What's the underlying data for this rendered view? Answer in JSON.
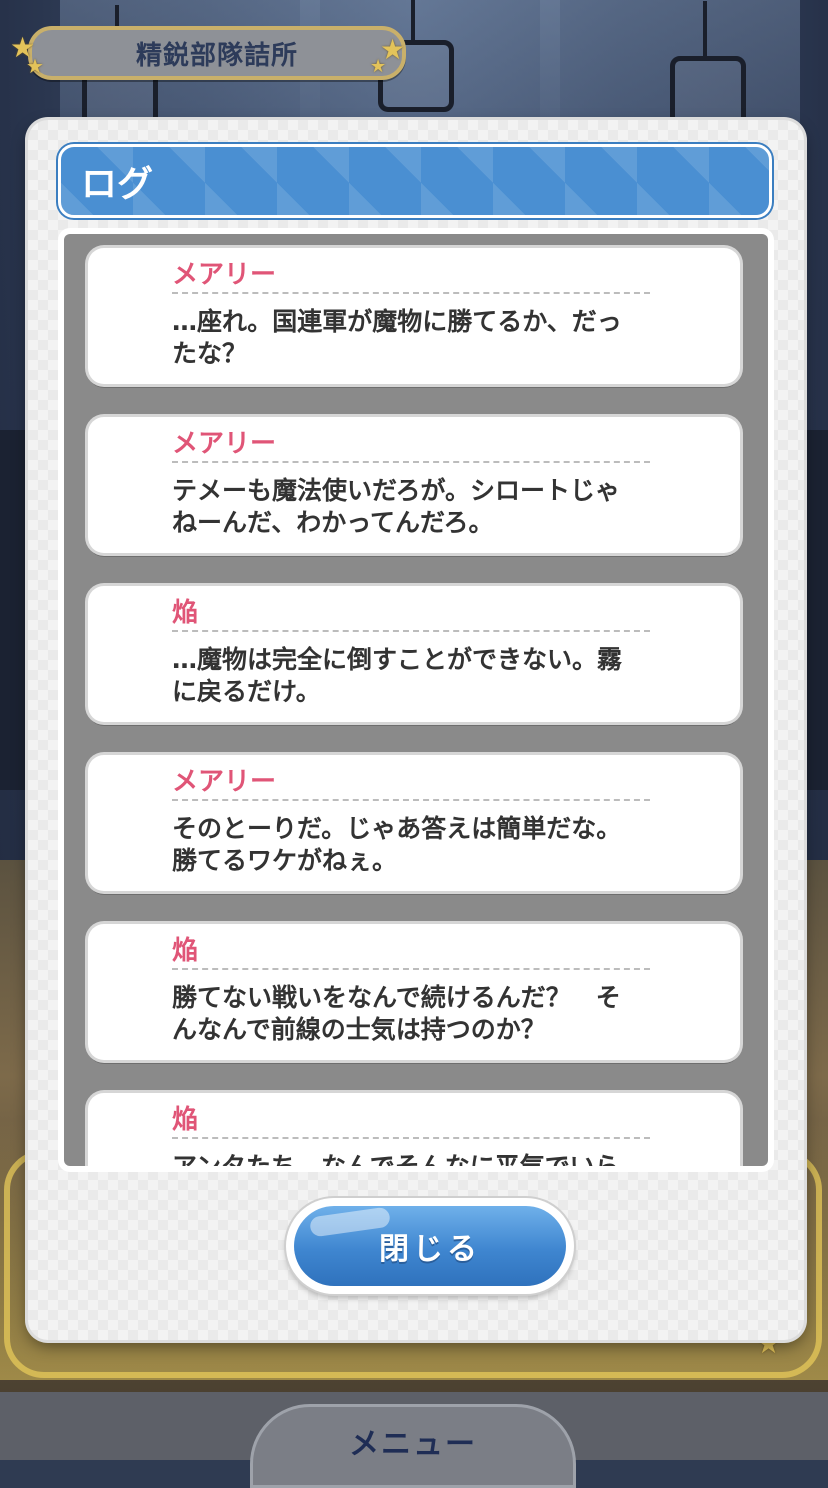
{
  "location": {
    "label": "精鋭部隊詰所"
  },
  "dialog": {
    "title": "ログ",
    "close_label": "閉じる"
  },
  "log_entries": [
    {
      "speaker": "メアリー",
      "text": "…座れ。国連軍が魔物に勝てるか、だっ\nたな？"
    },
    {
      "speaker": "メアリー",
      "text": "テメーも魔法使いだろが。シロートじゃ\nねーんだ、わかってんだろ。"
    },
    {
      "speaker": "焔",
      "text": "…魔物は完全に倒すことができない。霧\nに戻るだけ。"
    },
    {
      "speaker": "メアリー",
      "text": "そのとーりだ。じゃあ答えは簡単だな。\n勝てるワケがねぇ。"
    },
    {
      "speaker": "焔",
      "text": "勝てない戦いをなんで続けるんだ？　そ\nんなんで前線の士気は持つのか？"
    },
    {
      "speaker": "焔",
      "text": "アンタたち、なんでそんなに平気でいら"
    }
  ],
  "bottom_menu": {
    "label": "メニュー"
  },
  "colors": {
    "speaker": "#e05577",
    "header": "#4a8fd2",
    "button": "#3f86d0"
  }
}
